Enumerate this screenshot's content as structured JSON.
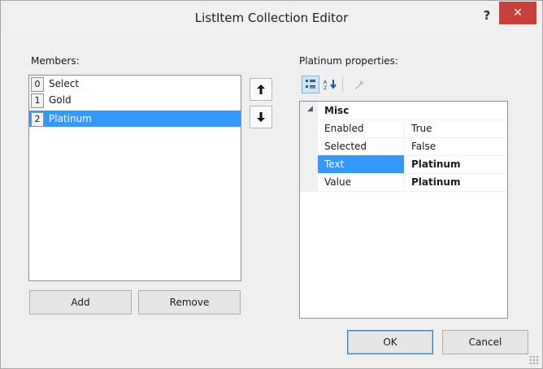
{
  "window": {
    "title": "ListItem Collection Editor",
    "help_label": "?",
    "close_label": "✕"
  },
  "members": {
    "label": "Members:",
    "items": [
      {
        "index": "0",
        "text": "Select",
        "selected": false
      },
      {
        "index": "1",
        "text": "Gold",
        "selected": false
      },
      {
        "index": "2",
        "text": "Platinum",
        "selected": true
      }
    ],
    "move_up_icon": "↑",
    "move_down_icon": "↓",
    "add_label": "Add",
    "remove_label": "Remove"
  },
  "properties": {
    "label": "Platinum properties:",
    "toolbar": {
      "categorized_icon": "categorized-icon",
      "alphabetical_icon": "alphabetical-icon",
      "property_pages_icon": "wrench-icon"
    },
    "category": {
      "toggle": "◢",
      "name": "Misc"
    },
    "rows": [
      {
        "name": "Enabled",
        "value": "True",
        "bold": false,
        "selected": false
      },
      {
        "name": "Selected",
        "value": "False",
        "bold": false,
        "selected": false
      },
      {
        "name": "Text",
        "value": "Platinum",
        "bold": true,
        "selected": true
      },
      {
        "name": "Value",
        "value": "Platinum",
        "bold": true,
        "selected": false
      }
    ]
  },
  "footer": {
    "ok_label": "OK",
    "cancel_label": "Cancel"
  },
  "colors": {
    "selection": "#3399ff",
    "close_button": "#c7403a"
  }
}
